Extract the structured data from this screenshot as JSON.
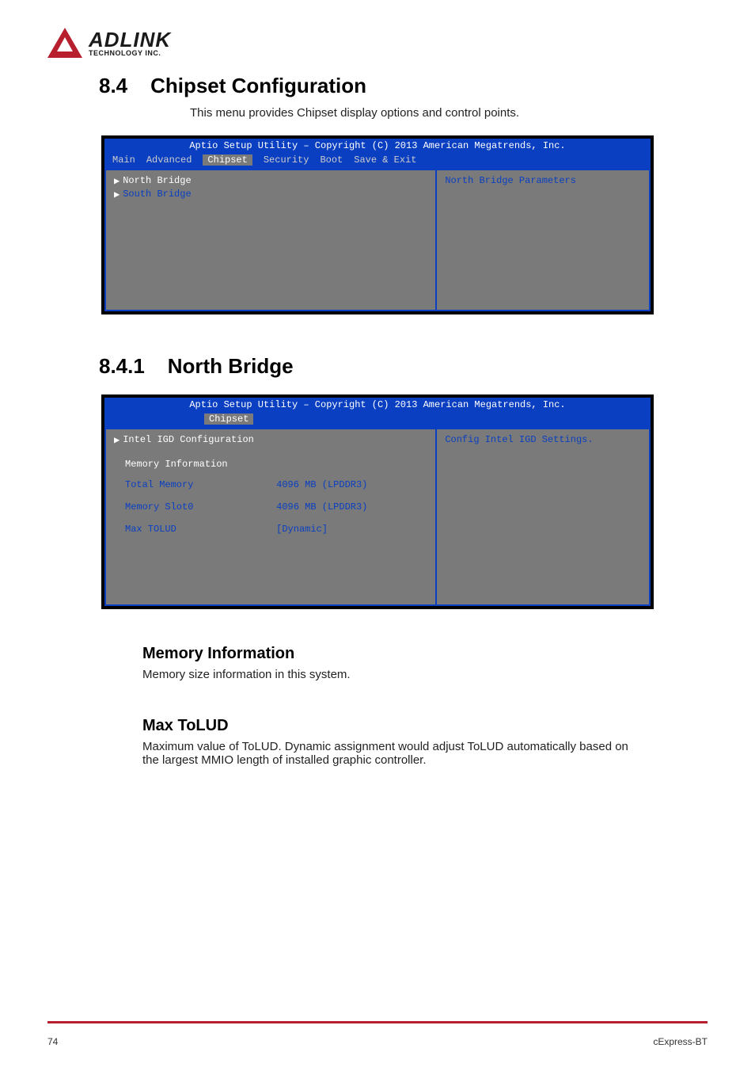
{
  "logo": {
    "main": "ADLINK",
    "sub": "TECHNOLOGY INC."
  },
  "section_num": "8.4",
  "section_title": "Chipset Configuration",
  "section_desc": "This menu provides Chipset display options and control points.",
  "bios1": {
    "title": "Aptio Setup Utility – Copyright (C) 2013 American Megatrends, Inc.",
    "menu": [
      "Main",
      "Advanced",
      "Chipset",
      "Security",
      "Boot",
      "Save & Exit"
    ],
    "active_tab": "Chipset",
    "items": [
      {
        "label": "North Bridge"
      },
      {
        "label": "South Bridge"
      }
    ],
    "help": "North Bridge Parameters"
  },
  "sub_num": "8.4.1",
  "sub_title": "North Bridge",
  "bios2": {
    "title": "Aptio Setup Utility – Copyright (C) 2013 American Megatrends, Inc.",
    "active_tab": "Chipset",
    "config_item": "Intel IGD Configuration",
    "section": "Memory Information",
    "rows": [
      {
        "label": "Total Memory",
        "value": "4096 MB (LPDDR3)"
      },
      {
        "label": "Memory Slot0",
        "value": "4096 MB (LPDDR3)"
      }
    ],
    "option": {
      "label": "Max TOLUD",
      "value": "[Dynamic]"
    },
    "help": "Config Intel IGD Settings."
  },
  "mem_heading": "Memory Information",
  "mem_desc": "Memory size information in this system.",
  "tolud_heading": "Max ToLUD",
  "tolud_desc": "Maximum value of ToLUD. Dynamic assignment would adjust ToLUD automatically based on the largest MMIO length of installed graphic controller.",
  "footer": {
    "page": "74",
    "product": "cExpress-BT"
  }
}
